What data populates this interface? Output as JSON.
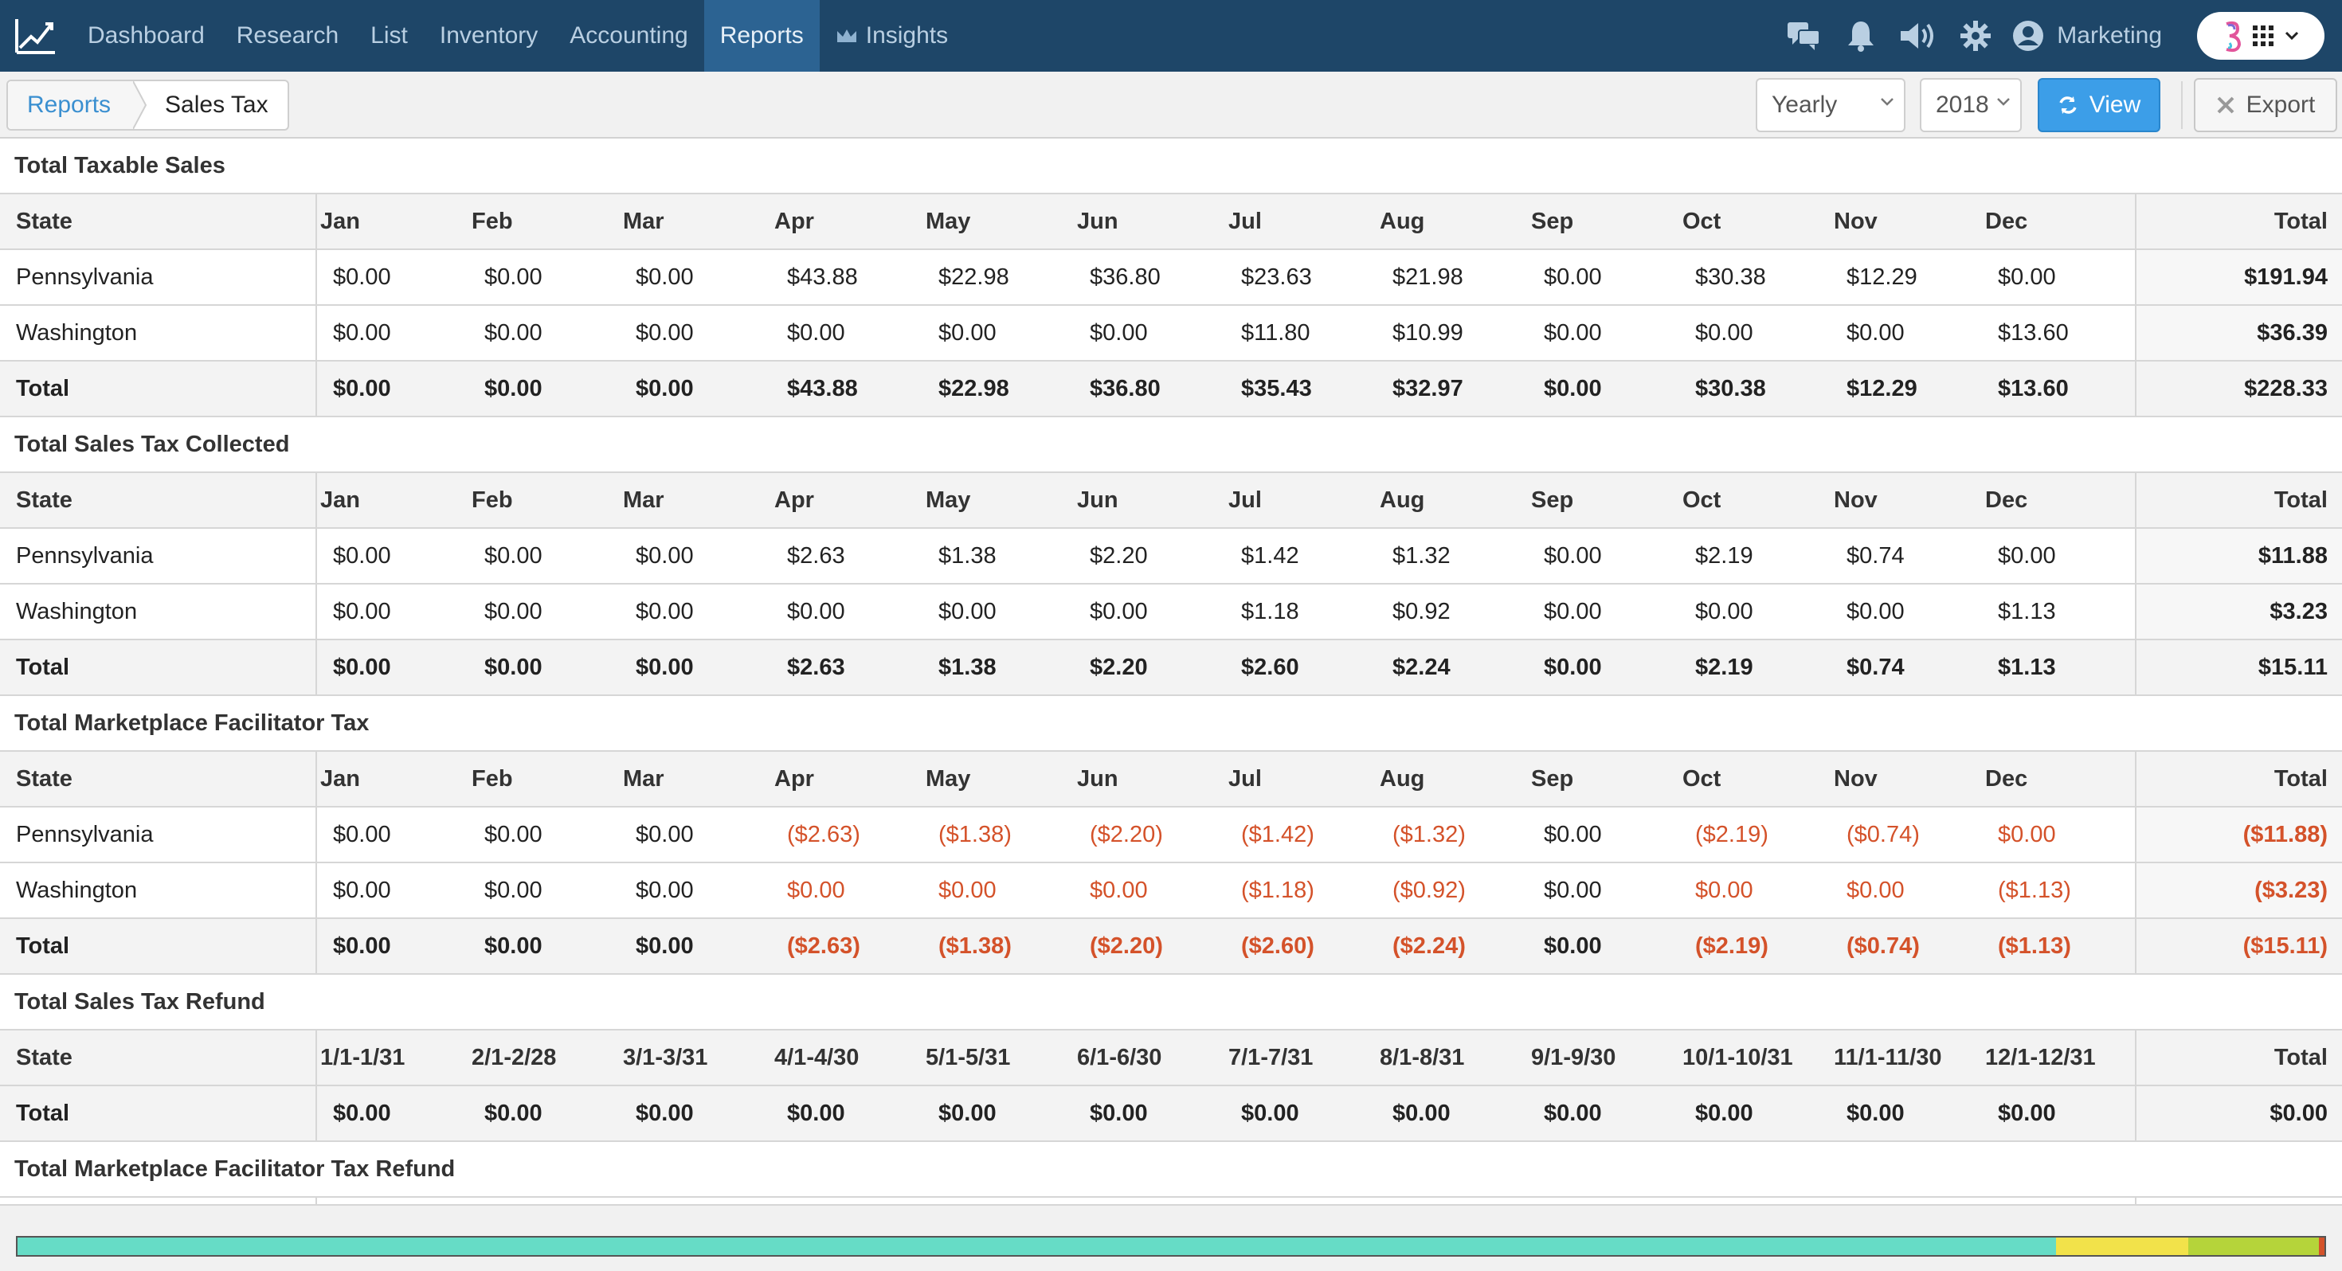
{
  "nav": {
    "items": [
      {
        "label": "Dashboard",
        "active": false
      },
      {
        "label": "Research",
        "active": false
      },
      {
        "label": "List",
        "active": false
      },
      {
        "label": "Inventory",
        "active": false
      },
      {
        "label": "Accounting",
        "active": false
      },
      {
        "label": "Reports",
        "active": true
      },
      {
        "label": "Insights",
        "active": false
      }
    ],
    "user_label": "Marketing",
    "icons": [
      "chat-icon",
      "bell-icon",
      "speaker-icon",
      "gear-icon",
      "user-icon",
      "apps-grid-icon"
    ],
    "colors": {
      "bar": "#1e4668",
      "active": "#2c6392"
    }
  },
  "breadcrumb": {
    "parent": "Reports",
    "current": "Sales Tax"
  },
  "toolbar": {
    "period_select": "Yearly",
    "year_select": "2018",
    "view_label": "View",
    "export_label": "Export"
  },
  "sections": [
    {
      "title": "Total Taxable Sales",
      "columns": [
        "State",
        "Jan",
        "Feb",
        "Mar",
        "Apr",
        "May",
        "Jun",
        "Jul",
        "Aug",
        "Sep",
        "Oct",
        "Nov",
        "Dec",
        "Total"
      ],
      "rows": [
        {
          "state": "Pennsylvania",
          "values": [
            "$0.00",
            "$0.00",
            "$0.00",
            "$43.88",
            "$22.98",
            "$36.80",
            "$23.63",
            "$21.98",
            "$0.00",
            "$30.38",
            "$12.29",
            "$0.00"
          ],
          "total": "$191.94"
        },
        {
          "state": "Washington",
          "values": [
            "$0.00",
            "$0.00",
            "$0.00",
            "$0.00",
            "$0.00",
            "$0.00",
            "$11.80",
            "$10.99",
            "$0.00",
            "$0.00",
            "$0.00",
            "$13.60"
          ],
          "total": "$36.39"
        }
      ],
      "totals": {
        "label": "Total",
        "values": [
          "$0.00",
          "$0.00",
          "$0.00",
          "$43.88",
          "$22.98",
          "$36.80",
          "$35.43",
          "$32.97",
          "$0.00",
          "$30.38",
          "$12.29",
          "$13.60"
        ],
        "total": "$228.33"
      }
    },
    {
      "title": "Total Sales Tax Collected",
      "columns": [
        "State",
        "Jan",
        "Feb",
        "Mar",
        "Apr",
        "May",
        "Jun",
        "Jul",
        "Aug",
        "Sep",
        "Oct",
        "Nov",
        "Dec",
        "Total"
      ],
      "rows": [
        {
          "state": "Pennsylvania",
          "values": [
            "$0.00",
            "$0.00",
            "$0.00",
            "$2.63",
            "$1.38",
            "$2.20",
            "$1.42",
            "$1.32",
            "$0.00",
            "$2.19",
            "$0.74",
            "$0.00"
          ],
          "total": "$11.88"
        },
        {
          "state": "Washington",
          "values": [
            "$0.00",
            "$0.00",
            "$0.00",
            "$0.00",
            "$0.00",
            "$0.00",
            "$1.18",
            "$0.92",
            "$0.00",
            "$0.00",
            "$0.00",
            "$1.13"
          ],
          "total": "$3.23"
        }
      ],
      "totals": {
        "label": "Total",
        "values": [
          "$0.00",
          "$0.00",
          "$0.00",
          "$2.63",
          "$1.38",
          "$2.20",
          "$2.60",
          "$2.24",
          "$0.00",
          "$2.19",
          "$0.74",
          "$1.13"
        ],
        "total": "$15.11"
      }
    },
    {
      "title": "Total Marketplace Facilitator Tax",
      "columns": [
        "State",
        "Jan",
        "Feb",
        "Mar",
        "Apr",
        "May",
        "Jun",
        "Jul",
        "Aug",
        "Sep",
        "Oct",
        "Nov",
        "Dec",
        "Total"
      ],
      "negative_color": "#d4522a",
      "rows": [
        {
          "state": "Pennsylvania",
          "values": [
            "$0.00",
            "$0.00",
            "$0.00",
            "($2.63)",
            "($1.38)",
            "($2.20)",
            "($1.42)",
            "($1.32)",
            "$0.00",
            "($2.19)",
            "($0.74)",
            "$0.00"
          ],
          "total": "($11.88)",
          "red": [
            false,
            false,
            false,
            true,
            true,
            true,
            true,
            true,
            false,
            true,
            true,
            true
          ],
          "total_red": true
        },
        {
          "state": "Washington",
          "values": [
            "$0.00",
            "$0.00",
            "$0.00",
            "$0.00",
            "$0.00",
            "$0.00",
            "($1.18)",
            "($0.92)",
            "$0.00",
            "$0.00",
            "$0.00",
            "($1.13)"
          ],
          "total": "($3.23)",
          "red": [
            false,
            false,
            false,
            true,
            true,
            true,
            true,
            true,
            false,
            true,
            true,
            true
          ],
          "total_red": true
        }
      ],
      "totals": {
        "label": "Total",
        "values": [
          "$0.00",
          "$0.00",
          "$0.00",
          "($2.63)",
          "($1.38)",
          "($2.20)",
          "($2.60)",
          "($2.24)",
          "$0.00",
          "($2.19)",
          "($0.74)",
          "($1.13)"
        ],
        "total": "($15.11)",
        "red": [
          false,
          false,
          false,
          true,
          true,
          true,
          true,
          true,
          false,
          true,
          true,
          true
        ],
        "total_red": true
      }
    },
    {
      "title": "Total Sales Tax Refund",
      "columns": [
        "State",
        "1/1-1/31",
        "2/1-2/28",
        "3/1-3/31",
        "4/1-4/30",
        "5/1-5/31",
        "6/1-6/30",
        "7/1-7/31",
        "8/1-8/31",
        "9/1-9/30",
        "10/1-10/31",
        "11/1-11/30",
        "12/1-12/31",
        "Total"
      ],
      "rows": [],
      "totals": {
        "label": "Total",
        "values": [
          "$0.00",
          "$0.00",
          "$0.00",
          "$0.00",
          "$0.00",
          "$0.00",
          "$0.00",
          "$0.00",
          "$0.00",
          "$0.00",
          "$0.00",
          "$0.00"
        ],
        "total": "$0.00"
      }
    },
    {
      "title": "Total Marketplace Facilitator Tax Refund",
      "columns": [],
      "rows": [],
      "totals": null
    }
  ],
  "progress": {
    "segments": [
      {
        "fraction": 0.8835,
        "color": "#66dcc6"
      },
      {
        "fraction": 0.0575,
        "color": "#f2e24a"
      },
      {
        "fraction": 0.0566,
        "color": "#b5d43a"
      },
      {
        "fraction": 0.0024,
        "color": "#d4522a"
      }
    ]
  }
}
